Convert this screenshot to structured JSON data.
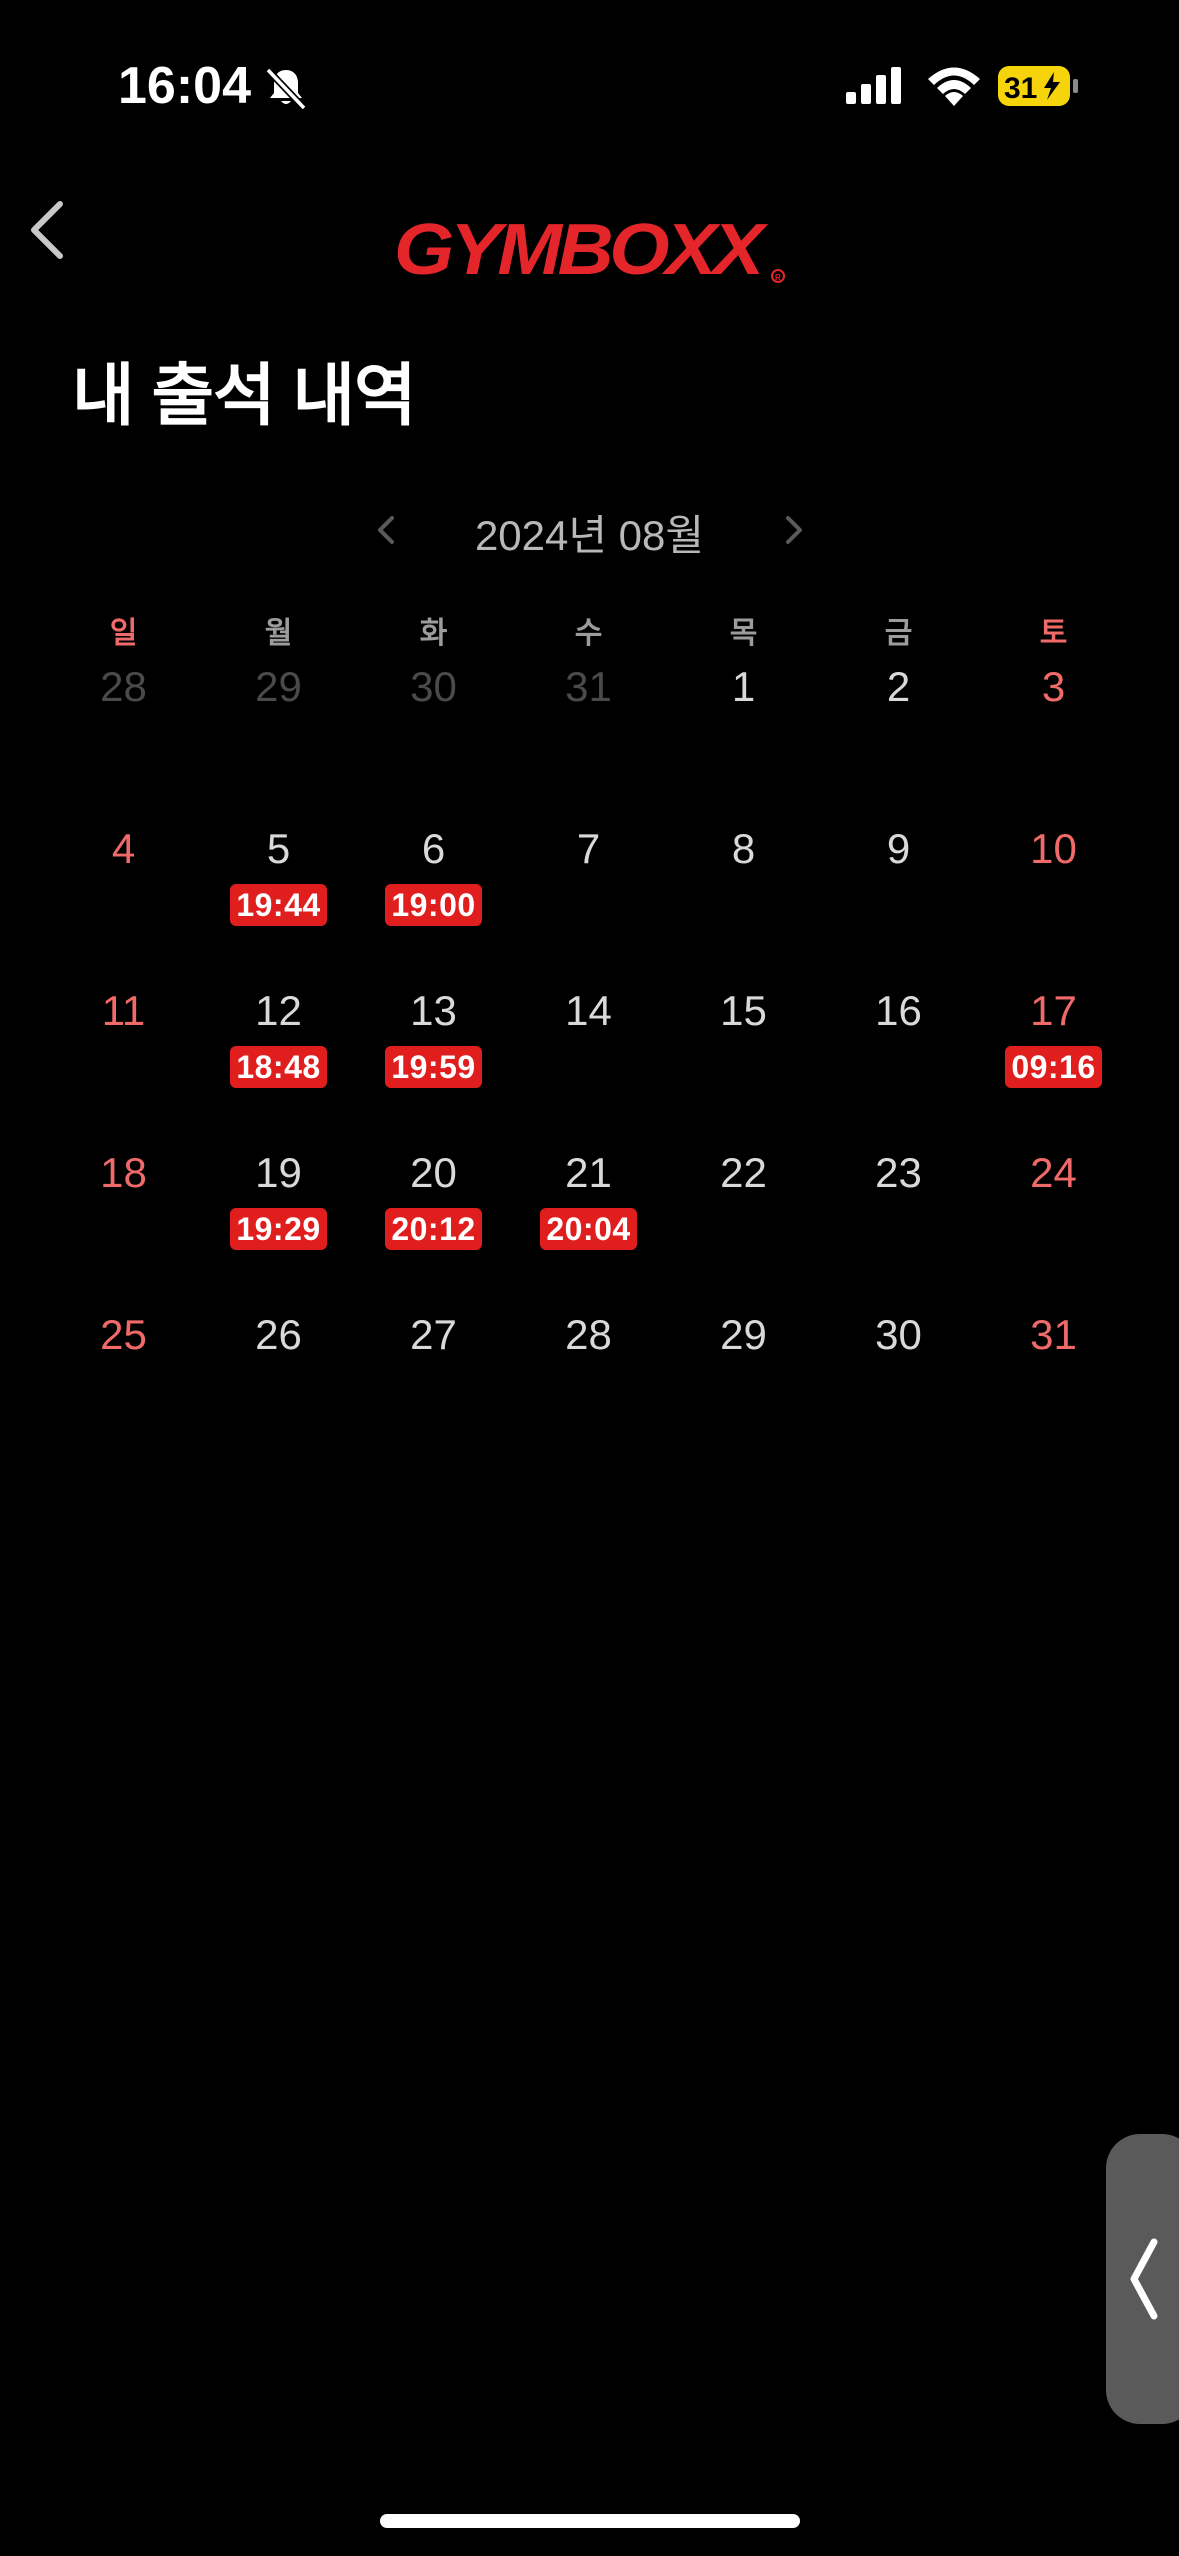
{
  "status_bar": {
    "time": "16:04",
    "battery_level": "31",
    "icons": [
      "bell-slash-icon",
      "signal-icon",
      "wifi-icon",
      "battery-charging-icon"
    ]
  },
  "header": {
    "back_icon": "chevron-left-icon",
    "logo_text": "GYMBOXX",
    "logo_color": "#e4262a"
  },
  "page": {
    "title": "내 출석 내역"
  },
  "calendar": {
    "month_label": "2024년 08월",
    "prev_icon": "chevron-left-icon",
    "next_icon": "chevron-right-icon",
    "weekdays": [
      "일",
      "월",
      "화",
      "수",
      "목",
      "금",
      "토"
    ],
    "weeks": [
      [
        {
          "day": "28",
          "muted": true
        },
        {
          "day": "29",
          "muted": true
        },
        {
          "day": "30",
          "muted": true
        },
        {
          "day": "31",
          "muted": true
        },
        {
          "day": "1"
        },
        {
          "day": "2"
        },
        {
          "day": "3"
        }
      ],
      [
        {
          "day": "4"
        },
        {
          "day": "5",
          "time": "19:44"
        },
        {
          "day": "6",
          "time": "19:00"
        },
        {
          "day": "7"
        },
        {
          "day": "8"
        },
        {
          "day": "9"
        },
        {
          "day": "10"
        }
      ],
      [
        {
          "day": "11"
        },
        {
          "day": "12",
          "time": "18:48"
        },
        {
          "day": "13",
          "time": "19:59"
        },
        {
          "day": "14"
        },
        {
          "day": "15"
        },
        {
          "day": "16"
        },
        {
          "day": "17",
          "time": "09:16"
        }
      ],
      [
        {
          "day": "18"
        },
        {
          "day": "19",
          "time": "19:29"
        },
        {
          "day": "20",
          "time": "20:12"
        },
        {
          "day": "21",
          "time": "20:04"
        },
        {
          "day": "22"
        },
        {
          "day": "23"
        },
        {
          "day": "24"
        }
      ],
      [
        {
          "day": "25"
        },
        {
          "day": "26"
        },
        {
          "day": "27"
        },
        {
          "day": "28"
        },
        {
          "day": "29"
        },
        {
          "day": "30"
        },
        {
          "day": "31"
        }
      ]
    ],
    "colors": {
      "weekend": "#f06a6a",
      "badge": "#e01e1e",
      "muted": "#4a4a4a"
    }
  },
  "side_handle": {
    "icon": "chevron-left-icon"
  }
}
